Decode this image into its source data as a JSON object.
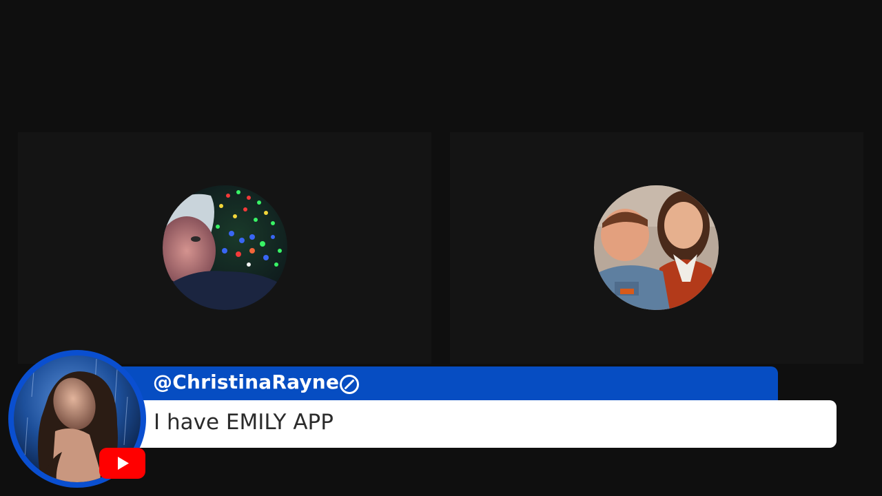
{
  "participants": [
    {
      "role": "video-tile-left",
      "avatar": "christmas-lights-selfie"
    },
    {
      "role": "video-tile-right",
      "avatar": "childhood-photo"
    }
  ],
  "comment": {
    "username": "@ChristinaRayne",
    "message": "I have EMILY APP",
    "platform_icon": "youtube-icon",
    "verified_icon": "slash-circle-icon"
  },
  "colors": {
    "background": "#0f0f0f",
    "tile": "#141414",
    "banner_blue": "#064dc2",
    "message_bg": "#ffffff",
    "youtube_red": "#ff0000"
  }
}
